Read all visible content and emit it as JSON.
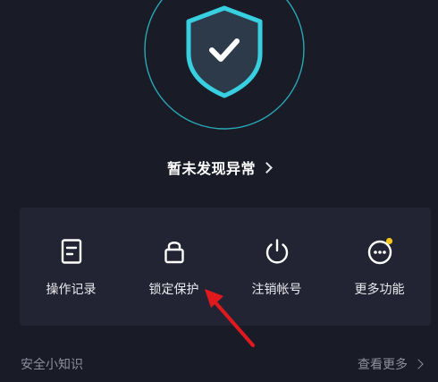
{
  "status": {
    "text": "暂未发现异常",
    "icon": "chevron-right-icon"
  },
  "shield": {
    "icon": "shield-check-icon",
    "ring_color": "#2cc1cf",
    "fill_color": "#2d3a49",
    "stroke_color": "#38cfe0"
  },
  "actions": [
    {
      "label": "操作记录",
      "icon": "document-icon"
    },
    {
      "label": "锁定保护",
      "icon": "lock-icon"
    },
    {
      "label": "注销帐号",
      "icon": "power-icon"
    },
    {
      "label": "更多功能",
      "icon": "more-dots-icon",
      "badge_color": "#f5c518"
    }
  ],
  "annotation": {
    "color": "#e0191f"
  },
  "footer": {
    "title": "安全小知识",
    "more_label": "查看更多"
  }
}
